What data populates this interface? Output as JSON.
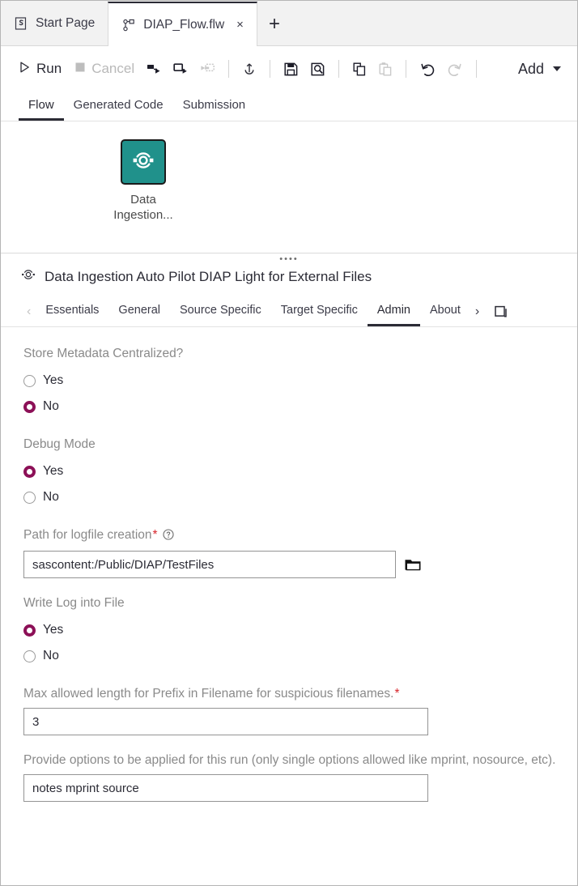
{
  "window": {
    "tabs": [
      {
        "label": "Start Page",
        "icon": "sas-logo-icon",
        "active": false,
        "closable": false
      },
      {
        "label": "DIAP_Flow.flw",
        "icon": "flow-icon",
        "active": true,
        "closable": true,
        "close_glyph": "×"
      }
    ],
    "new_tab_glyph": "+"
  },
  "toolbar": {
    "run_label": "Run",
    "run_icon": "play-icon",
    "cancel_label": "Cancel",
    "cancel_icon": "stop-icon",
    "icons": [
      {
        "name": "run-node-icon",
        "disabled": false
      },
      {
        "name": "run-from-node-icon",
        "disabled": false
      },
      {
        "name": "run-to-node-icon",
        "disabled": true
      },
      {
        "name": "upload-icon",
        "disabled": false
      },
      {
        "name": "save-icon",
        "disabled": false
      },
      {
        "name": "save-as-icon",
        "disabled": false
      },
      {
        "name": "copy-icon",
        "disabled": false
      },
      {
        "name": "paste-icon",
        "disabled": true
      },
      {
        "name": "undo-icon",
        "disabled": false
      },
      {
        "name": "redo-icon",
        "disabled": true
      }
    ],
    "add_label": "Add",
    "add_caret_icon": "chevron-down-icon"
  },
  "view_tabs": [
    {
      "label": "Flow",
      "active": true
    },
    {
      "label": "Generated Code",
      "active": false
    },
    {
      "label": "Submission",
      "active": false
    }
  ],
  "canvas": {
    "node": {
      "label": "Data\nIngestion...",
      "label_line1": "Data",
      "label_line2": "Ingestion...",
      "icon": "data-ingestion-icon",
      "color": "#20918b"
    }
  },
  "properties": {
    "grip_glyph": "••••",
    "title": "Data Ingestion Auto Pilot DIAP Light for External Files",
    "title_icon": "data-ingestion-icon",
    "prev_arrow_glyph": "‹",
    "next_arrow_glyph": "›",
    "expand_icon": "restore-panel-icon",
    "tabs": [
      {
        "label": "Essentials",
        "active": false
      },
      {
        "label": "General",
        "active": false
      },
      {
        "label": "Source Specific",
        "active": false
      },
      {
        "label": "Target Specific",
        "active": false
      },
      {
        "label": "Admin",
        "active": true
      },
      {
        "label": "About",
        "active": false
      }
    ]
  },
  "form": {
    "fields": [
      {
        "type": "radio",
        "label": "Store Metadata Centralized?",
        "required": false,
        "help": false,
        "options": [
          {
            "label": "Yes",
            "selected": false
          },
          {
            "label": "No",
            "selected": true
          }
        ]
      },
      {
        "type": "radio",
        "label": "Debug Mode",
        "required": false,
        "help": false,
        "options": [
          {
            "label": "Yes",
            "selected": true
          },
          {
            "label": "No",
            "selected": false
          }
        ]
      },
      {
        "type": "text-browse",
        "label": "Path for logfile creation",
        "required": true,
        "help": true,
        "value": "sascontent:/Public/DIAP/TestFiles",
        "placeholder": "",
        "browse_icon": "folder-icon"
      },
      {
        "type": "radio",
        "label": "Write Log into File",
        "required": false,
        "help": false,
        "options": [
          {
            "label": "Yes",
            "selected": true
          },
          {
            "label": "No",
            "selected": false
          }
        ]
      },
      {
        "type": "text",
        "label": "Max allowed length for Prefix in Filename for suspicious filenames.",
        "required": true,
        "help": false,
        "value": "3",
        "placeholder": ""
      },
      {
        "type": "text",
        "label": "Provide options to be applied for this run (only single options allowed like mprint, nosource, etc).",
        "required": false,
        "help": false,
        "value": "notes mprint source",
        "placeholder": ""
      }
    ],
    "required_marker": "*",
    "help_icon": "question-circle-icon"
  },
  "colors": {
    "node_teal": "#20918b",
    "radio_selected": "#8c1057",
    "required_red": "#d8262c",
    "active_underline": "#2b2b35",
    "label_gray": "#8a8a8a"
  }
}
